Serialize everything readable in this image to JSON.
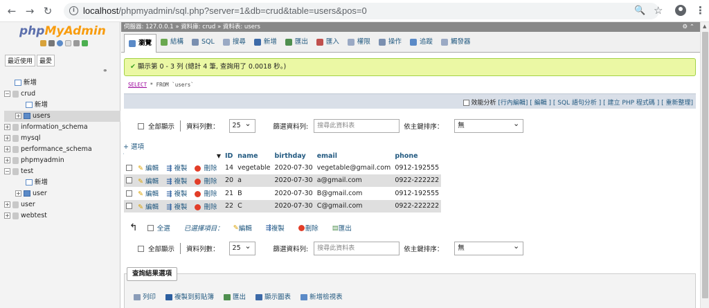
{
  "browser": {
    "url_host": "localhost",
    "url_rest": "/phpmyadmin/sql.php?server=1&db=crud&table=users&pos=0"
  },
  "nav": {
    "logo_a": "php",
    "logo_b": "MyAdmin",
    "tab_recent": "最近使用",
    "tab_fav": "最愛",
    "tree": [
      {
        "label": "新增",
        "kind": "new",
        "depth": 0
      },
      {
        "label": "crud",
        "kind": "db",
        "depth": 0,
        "expanded": true
      },
      {
        "label": "新增",
        "kind": "new",
        "depth": 1
      },
      {
        "label": "users",
        "kind": "table",
        "depth": 1,
        "selected": true
      },
      {
        "label": "information_schema",
        "kind": "db",
        "depth": 0
      },
      {
        "label": "mysql",
        "kind": "db",
        "depth": 0
      },
      {
        "label": "performance_schema",
        "kind": "db",
        "depth": 0
      },
      {
        "label": "phpmyadmin",
        "kind": "db",
        "depth": 0
      },
      {
        "label": "test",
        "kind": "db",
        "depth": 0,
        "expanded": true
      },
      {
        "label": "新增",
        "kind": "new",
        "depth": 1
      },
      {
        "label": "user",
        "kind": "table",
        "depth": 1
      },
      {
        "label": "user",
        "kind": "db",
        "depth": 0
      },
      {
        "label": "webtest",
        "kind": "db",
        "depth": 0
      }
    ]
  },
  "breadcrumb": "伺服器: 127.0.0.1 » 資料庫: crud » 資料表: users",
  "tabs": [
    {
      "label": "瀏覽",
      "color": "#5b8ac7"
    },
    {
      "label": "結構",
      "color": "#6aa84f"
    },
    {
      "label": "SQL",
      "color": "#7a8fb0"
    },
    {
      "label": "搜尋",
      "color": "#9aa9c4"
    },
    {
      "label": "新增",
      "color": "#3d6aa8"
    },
    {
      "label": "匯出",
      "color": "#4f8f4f"
    },
    {
      "label": "匯入",
      "color": "#c0504d"
    },
    {
      "label": "權限",
      "color": "#9aa9c4"
    },
    {
      "label": "操作",
      "color": "#7a8fb0"
    },
    {
      "label": "追蹤",
      "color": "#5b8ac7"
    },
    {
      "label": "觸發器",
      "color": "#9aa9c4"
    }
  ],
  "success_msg": "顯示第 0 - 3 列 (總計 4 筆, 查詢用了 0.0018 秒。)",
  "sql": {
    "kw": "SELECT",
    "rest": " * FROM `users`"
  },
  "sql_links": {
    "profiling": "效能分析",
    "rest": "[行內編輯] [ 編輯 ] [ SQL 語句分析 ] [ 建立 PHP 程式碼 ] [ 重新整理]"
  },
  "controls": {
    "show_all": "全部顯示",
    "rows_label": "資料列數：",
    "rows_value": "25",
    "filter_label": "篩選資料列:",
    "filter_placeholder": "搜尋此資料表",
    "sort_label": "依主鍵排序：",
    "sort_value": "無"
  },
  "options_link": "+ 選項",
  "table": {
    "headers": [
      "ID",
      "name",
      "birthday",
      "email",
      "phone"
    ],
    "actions": {
      "edit": "編輯",
      "copy": "複製",
      "delete": "刪除"
    },
    "rows": [
      [
        "14",
        "vegetable",
        "2020-07-30",
        "vegetable@gmail.com",
        "0912-192555"
      ],
      [
        "20",
        "a",
        "2020-07-30",
        "a@gmail.com",
        "0922-222222"
      ],
      [
        "21",
        "B",
        "2020-07-30",
        "B@gmail.com",
        "0912-192555"
      ],
      [
        "22",
        "C",
        "2020-07-30",
        "C@gmail.com",
        "0922-222222"
      ]
    ]
  },
  "bulk": {
    "check_all": "全選",
    "with_selected": "已選擇項目：",
    "edit": "編輯",
    "copy": "複製",
    "delete": "刪除",
    "export": "匯出"
  },
  "query_ops": {
    "legend": "查詢結果選項",
    "print": "列印",
    "copy_clipboard": "複製到剪貼簿",
    "export": "匯出",
    "chart": "顯示圖表",
    "create_view": "新增檢視表"
  }
}
